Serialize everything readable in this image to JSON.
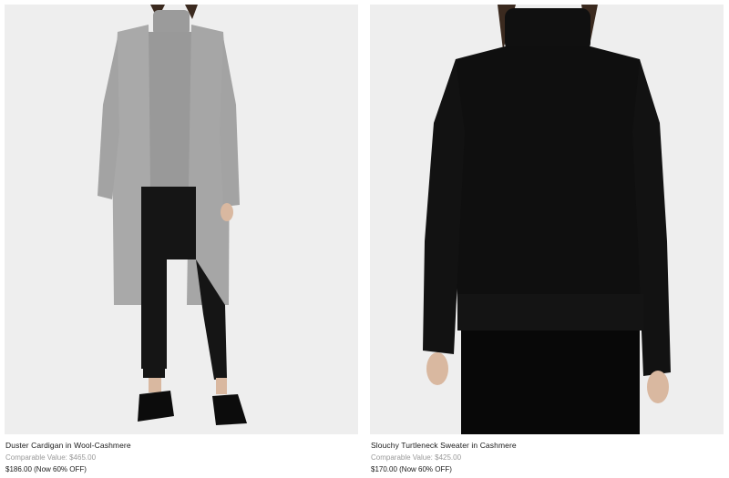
{
  "products": [
    {
      "name": "Duster Cardigan in Wool-Cashmere",
      "comparable": "Comparable Value: $465.00",
      "price": "$186.00 (Now 60% OFF)",
      "image_bg": "#eeeeee",
      "garment_color": "#a9a9a9"
    },
    {
      "name": "Slouchy Turtleneck Sweater in Cashmere",
      "comparable": "Comparable Value: $425.00",
      "price": "$170.00 (Now 60% OFF)",
      "image_bg": "#eeeeee",
      "garment_color": "#111111"
    }
  ]
}
